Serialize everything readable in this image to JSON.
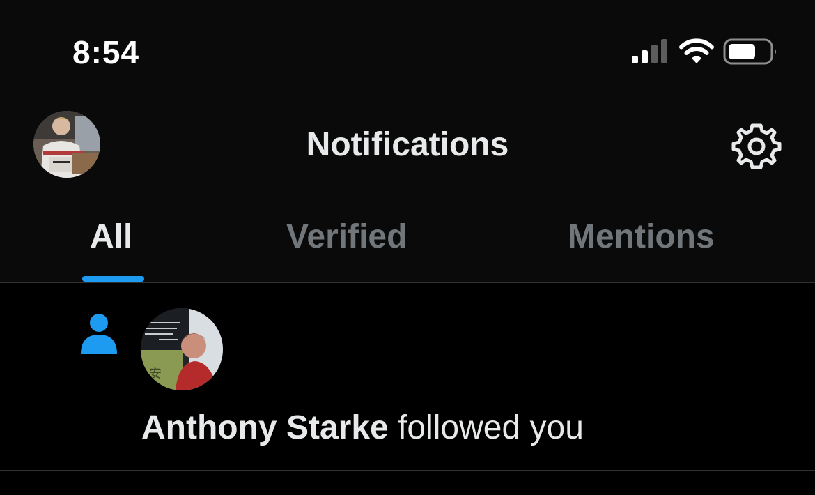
{
  "status_bar": {
    "time": "8:54",
    "icons": [
      "cellular-signal-icon",
      "wifi-icon",
      "battery-icon"
    ]
  },
  "header": {
    "title": "Notifications",
    "avatar": "user-avatar",
    "settings_icon": "gear-icon"
  },
  "tabs": [
    {
      "label": "All",
      "active": true
    },
    {
      "label": "Verified",
      "active": false
    },
    {
      "label": "Mentions",
      "active": false
    }
  ],
  "notifications": [
    {
      "type_icon": "person-icon",
      "avatar": "follower-avatar",
      "name": "Anthony Starke",
      "action": " followed you"
    }
  ],
  "colors": {
    "background": "#000000",
    "text_primary": "#e7e9ea",
    "text_secondary": "#71767b",
    "accent": "#1d9bf0",
    "divider": "#2f3336"
  }
}
